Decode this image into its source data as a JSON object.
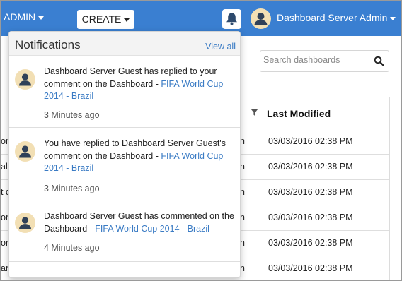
{
  "topbar": {
    "admin_label": "ADMIN",
    "create_label": "CREATE",
    "user_name": "Dashboard Server Admin"
  },
  "search": {
    "placeholder": "Search dashboards"
  },
  "table": {
    "header_last_modified": "Last Modified",
    "rows": [
      {
        "left": "or",
        "mid": "n",
        "date": "03/03/2016 02:38 PM"
      },
      {
        "left": "ale",
        "mid": "n",
        "date": "03/03/2016 02:38 PM"
      },
      {
        "left": "t d",
        "mid": "n",
        "date": "03/03/2016 02:38 PM"
      },
      {
        "left": "or",
        "mid": "n",
        "date": "03/03/2016 02:38 PM"
      },
      {
        "left": "or",
        "mid": "n",
        "date": "03/03/2016 02:38 PM"
      },
      {
        "left": "an",
        "mid": "n",
        "date": "03/03/2016 02:38 PM"
      }
    ]
  },
  "notifications": {
    "title": "Notifications",
    "view_all": "View all",
    "items": [
      {
        "text_before": "Dashboard Server Guest has replied to your comment on the Dashboard - ",
        "link": "FIFA World Cup 2014 - Brazil",
        "time": "3 Minutes ago"
      },
      {
        "text_before": "You have replied to Dashboard Server Guest's comment on the Dashboard - ",
        "link": "FIFA World Cup 2014 - Brazil",
        "time": "3 Minutes ago"
      },
      {
        "text_before": "Dashboard Server Guest has commented on the Dashboard - ",
        "link": "FIFA World Cup 2014 - Brazil",
        "time": "4 Minutes ago"
      }
    ]
  },
  "icons": {
    "bell": "bell-icon",
    "search": "search-icon",
    "filter": "filter-icon",
    "avatar": "user-avatar-icon"
  },
  "colors": {
    "topbar": "#3a7fd1",
    "link": "#3a7bc4",
    "avatar_bg": "#f2dfb4",
    "avatar_fg": "#2f4058"
  }
}
